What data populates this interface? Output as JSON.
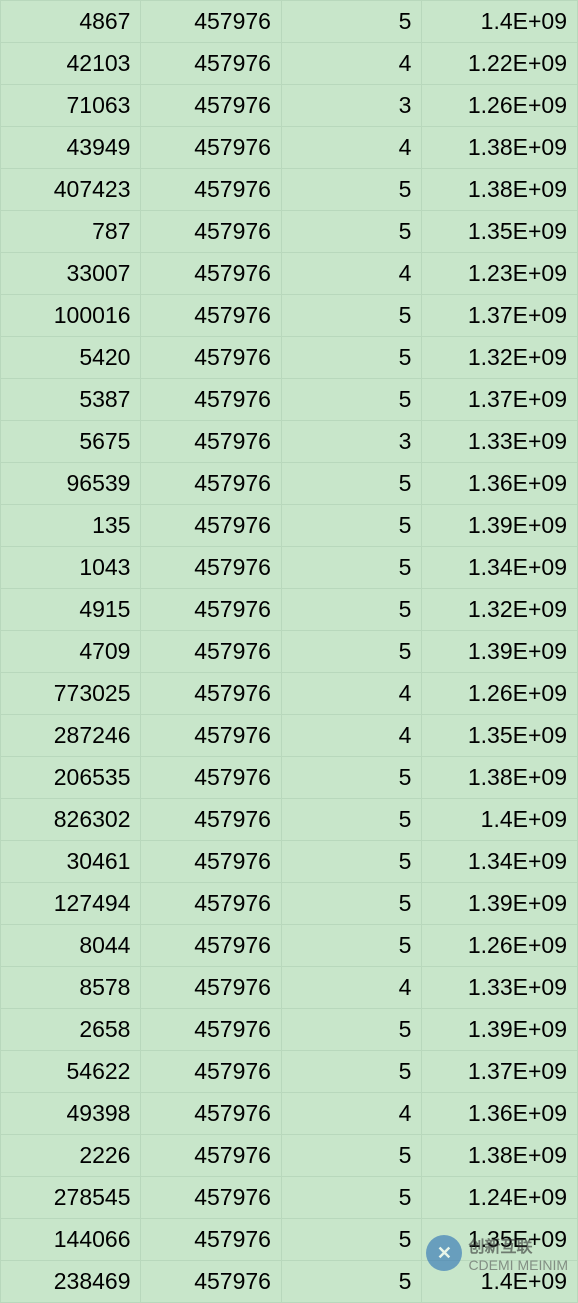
{
  "rows": [
    {
      "a": "4867",
      "b": "457976",
      "c": "5",
      "d": "1.4E+09"
    },
    {
      "a": "42103",
      "b": "457976",
      "c": "4",
      "d": "1.22E+09"
    },
    {
      "a": "71063",
      "b": "457976",
      "c": "3",
      "d": "1.26E+09"
    },
    {
      "a": "43949",
      "b": "457976",
      "c": "4",
      "d": "1.38E+09"
    },
    {
      "a": "407423",
      "b": "457976",
      "c": "5",
      "d": "1.38E+09"
    },
    {
      "a": "787",
      "b": "457976",
      "c": "5",
      "d": "1.35E+09"
    },
    {
      "a": "33007",
      "b": "457976",
      "c": "4",
      "d": "1.23E+09"
    },
    {
      "a": "100016",
      "b": "457976",
      "c": "5",
      "d": "1.37E+09"
    },
    {
      "a": "5420",
      "b": "457976",
      "c": "5",
      "d": "1.32E+09"
    },
    {
      "a": "5387",
      "b": "457976",
      "c": "5",
      "d": "1.37E+09"
    },
    {
      "a": "5675",
      "b": "457976",
      "c": "3",
      "d": "1.33E+09"
    },
    {
      "a": "96539",
      "b": "457976",
      "c": "5",
      "d": "1.36E+09"
    },
    {
      "a": "135",
      "b": "457976",
      "c": "5",
      "d": "1.39E+09"
    },
    {
      "a": "1043",
      "b": "457976",
      "c": "5",
      "d": "1.34E+09"
    },
    {
      "a": "4915",
      "b": "457976",
      "c": "5",
      "d": "1.32E+09"
    },
    {
      "a": "4709",
      "b": "457976",
      "c": "5",
      "d": "1.39E+09"
    },
    {
      "a": "773025",
      "b": "457976",
      "c": "4",
      "d": "1.26E+09"
    },
    {
      "a": "287246",
      "b": "457976",
      "c": "4",
      "d": "1.35E+09"
    },
    {
      "a": "206535",
      "b": "457976",
      "c": "5",
      "d": "1.38E+09"
    },
    {
      "a": "826302",
      "b": "457976",
      "c": "5",
      "d": "1.4E+09"
    },
    {
      "a": "30461",
      "b": "457976",
      "c": "5",
      "d": "1.34E+09"
    },
    {
      "a": "127494",
      "b": "457976",
      "c": "5",
      "d": "1.39E+09"
    },
    {
      "a": "8044",
      "b": "457976",
      "c": "5",
      "d": "1.26E+09"
    },
    {
      "a": "8578",
      "b": "457976",
      "c": "4",
      "d": "1.33E+09"
    },
    {
      "a": "2658",
      "b": "457976",
      "c": "5",
      "d": "1.39E+09"
    },
    {
      "a": "54622",
      "b": "457976",
      "c": "5",
      "d": "1.37E+09"
    },
    {
      "a": "49398",
      "b": "457976",
      "c": "4",
      "d": "1.36E+09"
    },
    {
      "a": "2226",
      "b": "457976",
      "c": "5",
      "d": "1.38E+09"
    },
    {
      "a": "278545",
      "b": "457976",
      "c": "5",
      "d": "1.24E+09"
    },
    {
      "a": "144066",
      "b": "457976",
      "c": "5",
      "d": "1.35E+09"
    },
    {
      "a": "238469",
      "b": "457976",
      "c": "5",
      "d": "1.4E+09"
    }
  ],
  "watermark": {
    "cn": "创新互联",
    "en": "CDEMI MEINIM"
  }
}
